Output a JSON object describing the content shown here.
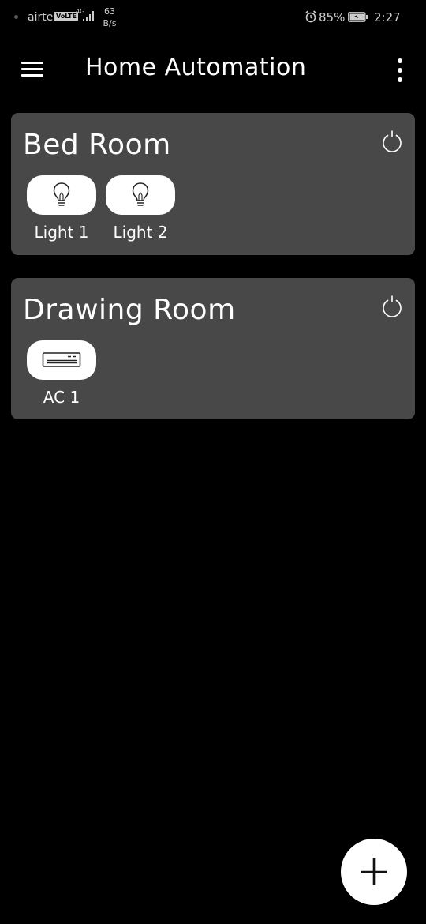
{
  "status_bar": {
    "carrier": "airtel",
    "volte": "VoLTE",
    "network": "4G",
    "speed_value": "63",
    "speed_unit": "B/s",
    "battery": "85%",
    "time": "2:27"
  },
  "app_bar": {
    "title": "Home Automation",
    "menu_icon": "hamburger-menu-icon",
    "overflow_icon": "more-vertical-icon"
  },
  "rooms": [
    {
      "name": "Bed Room",
      "power_icon": "power-icon",
      "devices": [
        {
          "label": "Light 1",
          "icon": "lightbulb-icon"
        },
        {
          "label": "Light 2",
          "icon": "lightbulb-icon"
        }
      ]
    },
    {
      "name": "Drawing Room",
      "power_icon": "power-icon",
      "devices": [
        {
          "label": "AC 1",
          "icon": "air-conditioner-icon"
        }
      ]
    }
  ],
  "fab": {
    "icon": "plus-icon"
  },
  "colors": {
    "background": "#000000",
    "card": "#484848",
    "text": "#ffffff",
    "device_button": "#ffffff"
  }
}
